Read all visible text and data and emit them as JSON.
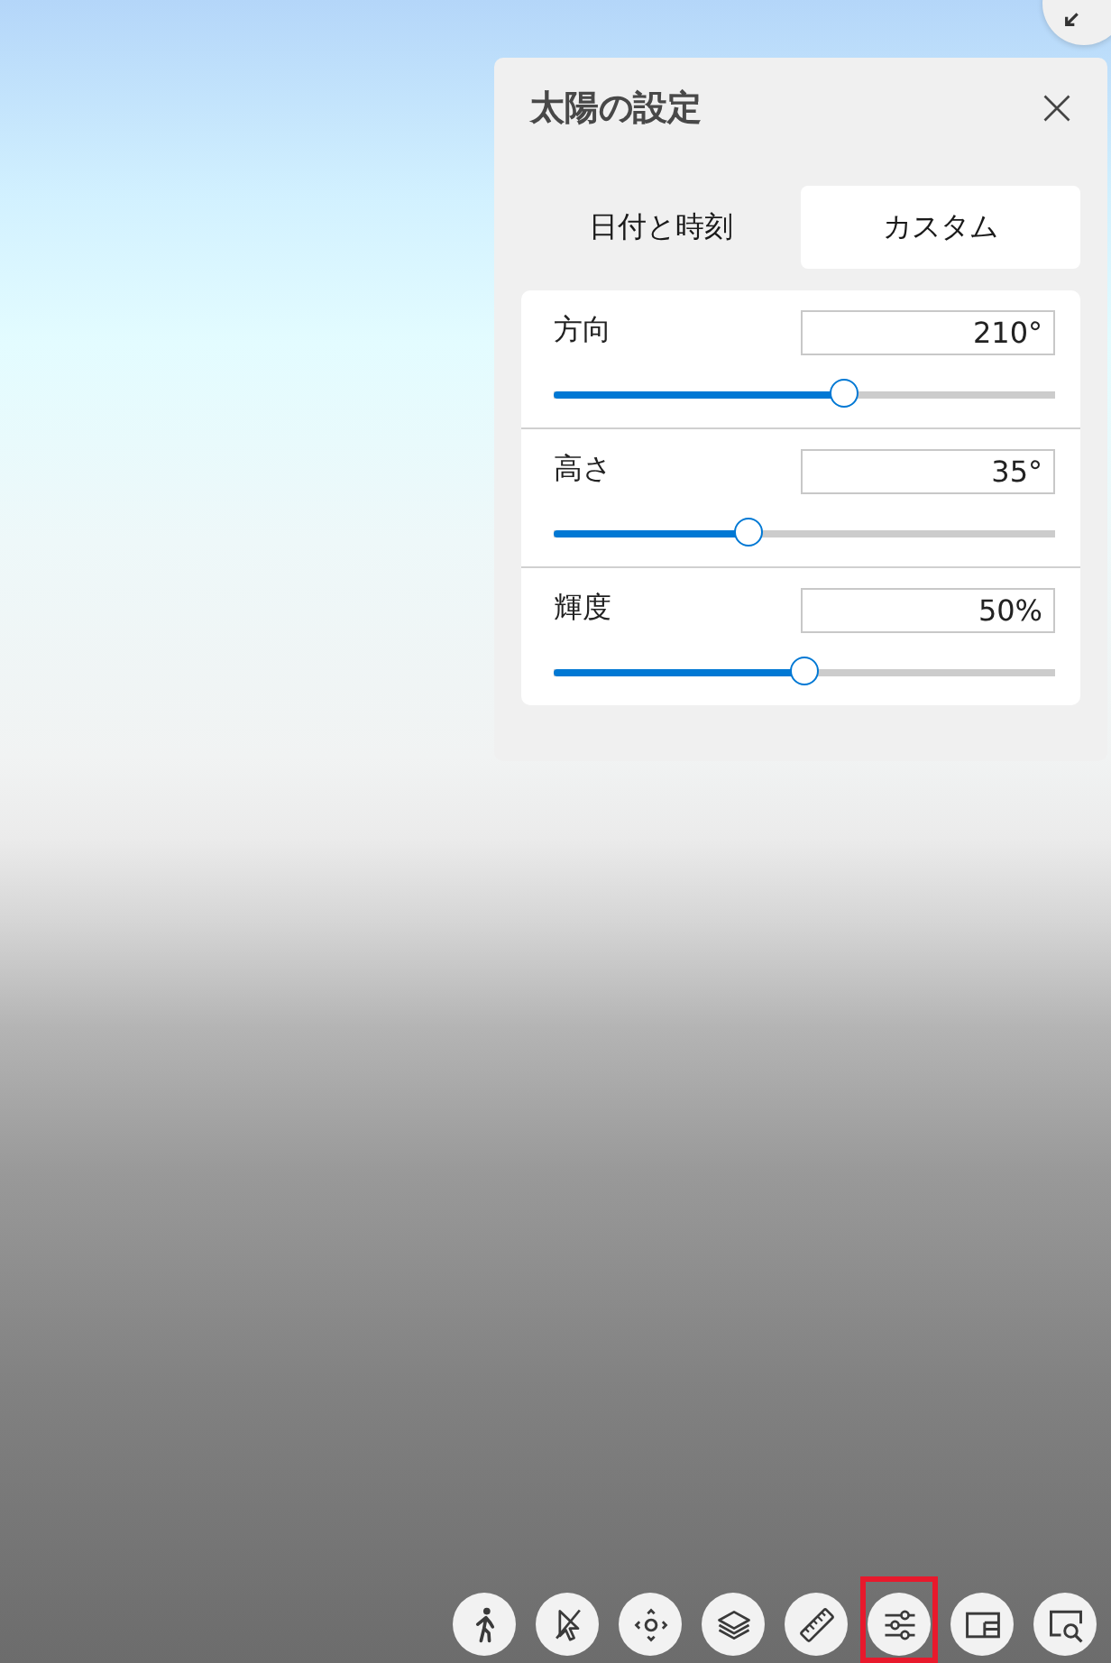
{
  "sun_panel": {
    "title": "太陽の設定",
    "tabs": [
      {
        "label": "日付と時刻",
        "selected": false
      },
      {
        "label": "カスタム",
        "selected": true
      }
    ],
    "settings": [
      {
        "label": "方向",
        "value": "210°",
        "level": 0.58
      },
      {
        "label": "高さ",
        "value": "35°",
        "level": 0.39
      },
      {
        "label": "輝度",
        "value": "50%",
        "level": 0.5
      }
    ]
  },
  "toolbar": [
    {
      "kind": "walk",
      "selected": false
    },
    {
      "kind": "select",
      "selected": false
    },
    {
      "kind": "orbit",
      "selected": false
    },
    {
      "kind": "layers",
      "selected": false
    },
    {
      "kind": "measure",
      "selected": false
    },
    {
      "kind": "settings",
      "selected": true
    },
    {
      "kind": "panel",
      "selected": false
    },
    {
      "kind": "zoom",
      "selected": false
    }
  ]
}
